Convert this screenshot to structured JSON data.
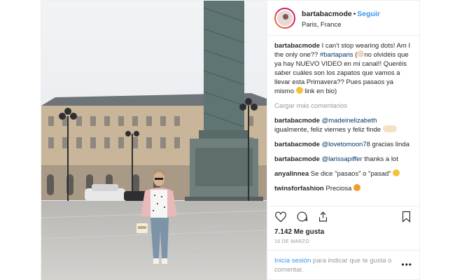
{
  "header": {
    "username": "bartabacmode",
    "follow_label": "Seguir",
    "location": "Paris, France"
  },
  "caption": {
    "username": "bartabacmode",
    "text_1": "I can't stop wearing dots! Am I the only one?? ",
    "hashtag": "#bartaparis",
    "text_2": " (",
    "text_3": "no olvidéis que ya hay NUEVO VIDEO en mi canal!! Queréis saber cuáles son los zapatos que vamos a llevar esta Primavera?? Pues pasaos ya mismo ",
    "text_4": " link en bio)"
  },
  "load_more": "Cargar más comentarios",
  "comments": [
    {
      "username": "bartabacmode",
      "mention": "@madeinelizabeth",
      "text": " igualmente, feliz viernes y feliz finde "
    },
    {
      "username": "bartabacmode",
      "mention": "@lovetomoon78",
      "text": " gracias linda"
    },
    {
      "username": "bartabacmode",
      "mention": "@larissapiffer",
      "text": " thanks a lot"
    },
    {
      "username": "anyalinnea",
      "mention": "",
      "text": " Se dice \"pasaos\" o \"pasad\""
    },
    {
      "username": "twinsforfashion",
      "mention": "",
      "text": " Preciosa "
    }
  ],
  "likes": "7.142 Me gusta",
  "date": "16 de marzo",
  "login": {
    "link": "Inicia sesión",
    "text": " para indicar que te gusta o comentar."
  },
  "icons": {
    "like": "heart-icon",
    "comment": "comment-icon",
    "share": "share-icon",
    "save": "bookmark-icon",
    "more": "more-options-icon"
  },
  "colors": {
    "link": "#3897f0",
    "text": "#262626",
    "muted": "#999999",
    "border": "#efefef"
  }
}
